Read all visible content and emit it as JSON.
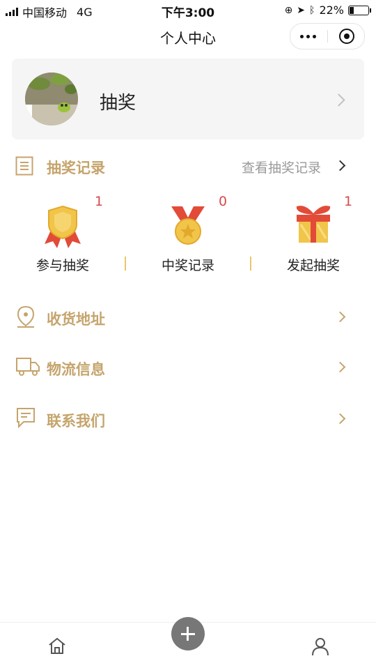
{
  "status_bar": {
    "carrier": "中国移动",
    "network": "4G",
    "time": "下午3:00",
    "battery": "22%"
  },
  "nav": {
    "title": "个人中心"
  },
  "profile": {
    "name": "抽奖"
  },
  "lottery": {
    "title": "抽奖记录",
    "view_all": "查看抽奖记录",
    "stats": [
      {
        "label": "参与抽奖",
        "count": "1",
        "icon": "badge-icon"
      },
      {
        "label": "中奖记录",
        "count": "0",
        "icon": "medal-icon"
      },
      {
        "label": "发起抽奖",
        "count": "1",
        "icon": "gift-icon"
      }
    ]
  },
  "menu": [
    {
      "label": "收货地址",
      "icon": "location-pin-icon"
    },
    {
      "label": "物流信息",
      "icon": "truck-icon"
    },
    {
      "label": "联系我们",
      "icon": "chat-icon"
    }
  ],
  "colors": {
    "accent_gold": "#c5a46c",
    "count_red": "#d64b4b",
    "profile_bg": "#f5f5f5"
  },
  "tabbar": {
    "items": [
      "home-icon",
      "add-icon",
      "person-icon"
    ]
  }
}
